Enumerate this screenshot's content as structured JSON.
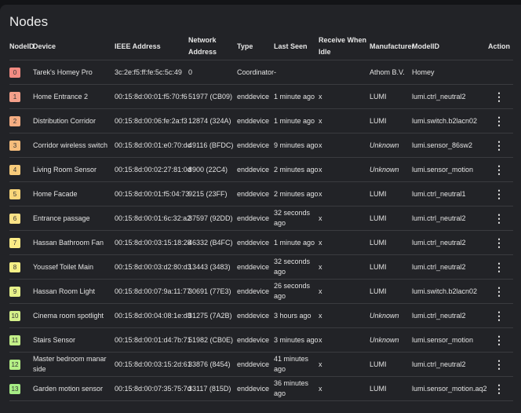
{
  "title": "Nodes",
  "headers": {
    "nodeid": "NodeID",
    "device": "Device",
    "ieee": "IEEE Address",
    "network": "Network Address",
    "type": "Type",
    "last_seen": "Last Seen",
    "rwi": "Receive When Idle",
    "manufacturer": "Manufacturer",
    "model": "ModelID",
    "action": "Action"
  },
  "rows": [
    {
      "id": "0",
      "color": "#f28b82",
      "device": "Tarek's Homey Pro",
      "ieee": "3c:2e:f5:ff:fe:5c:5c:49",
      "network": "0",
      "type": "Coordinator",
      "last_seen": "-",
      "rwi": "",
      "manufacturer": "Athom B.V.",
      "model": "Homey",
      "action": ""
    },
    {
      "id": "1",
      "color": "#f4a08a",
      "device": "Home Entrance 2",
      "ieee": "00:15:8d:00:01:f5:70:f6",
      "network": "51977 (CB09)",
      "type": "enddevice",
      "last_seen": "1 minute ago",
      "rwi": "x",
      "manufacturer": "LUMI",
      "model": "lumi.ctrl_neutral2",
      "action": "⋮"
    },
    {
      "id": "2",
      "color": "#f5ad82",
      "device": "Distribution Corridor",
      "ieee": "00:15:8d:00:06:fe:2a:f3",
      "network": "12874 (324A)",
      "type": "enddevice",
      "last_seen": "1 minute ago",
      "rwi": "x",
      "manufacturer": "LUMI",
      "model": "lumi.switch.b2lacn02",
      "action": "⋮"
    },
    {
      "id": "3",
      "color": "#f6bd7c",
      "device": "Corridor wireless switch",
      "ieee": "00:15:8d:00:01:e0:70:dc",
      "network": "49116 (BFDC)",
      "type": "enddevice",
      "last_seen": "9 minutes ago",
      "rwi": "x",
      "manufacturer": "Unknown",
      "model": "lumi.sensor_86sw2",
      "action": "⋮"
    },
    {
      "id": "4",
      "color": "#f8cb7a",
      "device": "Living Room Sensor",
      "ieee": "00:15:8d:00:02:27:81:0d",
      "network": "8900 (22C4)",
      "type": "enddevice",
      "last_seen": "2 minutes ago",
      "rwi": "x",
      "manufacturer": "Unknown",
      "model": "lumi.sensor_motion",
      "action": "⋮"
    },
    {
      "id": "5",
      "color": "#fad67a",
      "device": "Home Facade",
      "ieee": "00:15:8d:00:01:f5:04:73",
      "network": "9215 (23FF)",
      "type": "enddevice",
      "last_seen": "2 minutes ago",
      "rwi": "x",
      "manufacturer": "LUMI",
      "model": "lumi.ctrl_neutral1",
      "action": "⋮"
    },
    {
      "id": "6",
      "color": "#fbe286",
      "device": "Entrance passage",
      "ieee": "00:15:8d:00:01:6c:32:a2",
      "network": "37597 (92DD)",
      "type": "enddevice",
      "last_seen": "32 seconds ago",
      "rwi": "x",
      "manufacturer": "LUMI",
      "model": "lumi.ctrl_neutral2",
      "action": "⋮"
    },
    {
      "id": "7",
      "color": "#fbeb86",
      "device": "Hassan Bathroom Fan",
      "ieee": "00:15:8d:00:03:15:18:28",
      "network": "46332 (B4FC)",
      "type": "enddevice",
      "last_seen": "1 minute ago",
      "rwi": "x",
      "manufacturer": "LUMI",
      "model": "lumi.ctrl_neutral2",
      "action": "⋮"
    },
    {
      "id": "8",
      "color": "#f5ef86",
      "device": "Youssef Toilet Main",
      "ieee": "00:15:8d:00:03:d2:80:d3",
      "network": "13443 (3483)",
      "type": "enddevice",
      "last_seen": "32 seconds ago",
      "rwi": "x",
      "manufacturer": "LUMI",
      "model": "lumi.ctrl_neutral2",
      "action": "⋮"
    },
    {
      "id": "9",
      "color": "#e6f08a",
      "device": "Hassan Room Light",
      "ieee": "00:15:8d:00:07:9a:11:77",
      "network": "30691 (77E3)",
      "type": "enddevice",
      "last_seen": "26 seconds ago",
      "rwi": "x",
      "manufacturer": "LUMI",
      "model": "lumi.switch.b2lacn02",
      "action": "⋮"
    },
    {
      "id": "10",
      "color": "#d4f08a",
      "device": "Cinema room spotlight",
      "ieee": "00:15:8d:00:04:08:1e:d8",
      "network": "31275 (7A2B)",
      "type": "enddevice",
      "last_seen": "3 hours ago",
      "rwi": "x",
      "manufacturer": "Unknown",
      "model": "lumi.ctrl_neutral2",
      "action": "⋮"
    },
    {
      "id": "11",
      "color": "#c3ef88",
      "device": "Stairs Sensor",
      "ieee": "00:15:8d:00:01:d4:7b:71",
      "network": "51982 (CB0E)",
      "type": "enddevice",
      "last_seen": "3 minutes ago",
      "rwi": "x",
      "manufacturer": "Unknown",
      "model": "lumi.sensor_motion",
      "action": "⋮"
    },
    {
      "id": "12",
      "color": "#b4ee85",
      "device": "Master bedroom manar side",
      "ieee": "00:15:8d:00:03:15:2d:61",
      "network": "33876 (8454)",
      "type": "enddevice",
      "last_seen": "41 minutes ago",
      "rwi": "x",
      "manufacturer": "LUMI",
      "model": "lumi.ctrl_neutral2",
      "action": "⋮"
    },
    {
      "id": "13",
      "color": "#a6ec85",
      "device": "Garden motion sensor",
      "ieee": "00:15:8d:00:07:35:75:7d",
      "network": "33117 (815D)",
      "type": "enddevice",
      "last_seen": "36 minutes ago",
      "rwi": "x",
      "manufacturer": "LUMI",
      "model": "lumi.sensor_motion.aq2",
      "action": "⋮"
    }
  ]
}
